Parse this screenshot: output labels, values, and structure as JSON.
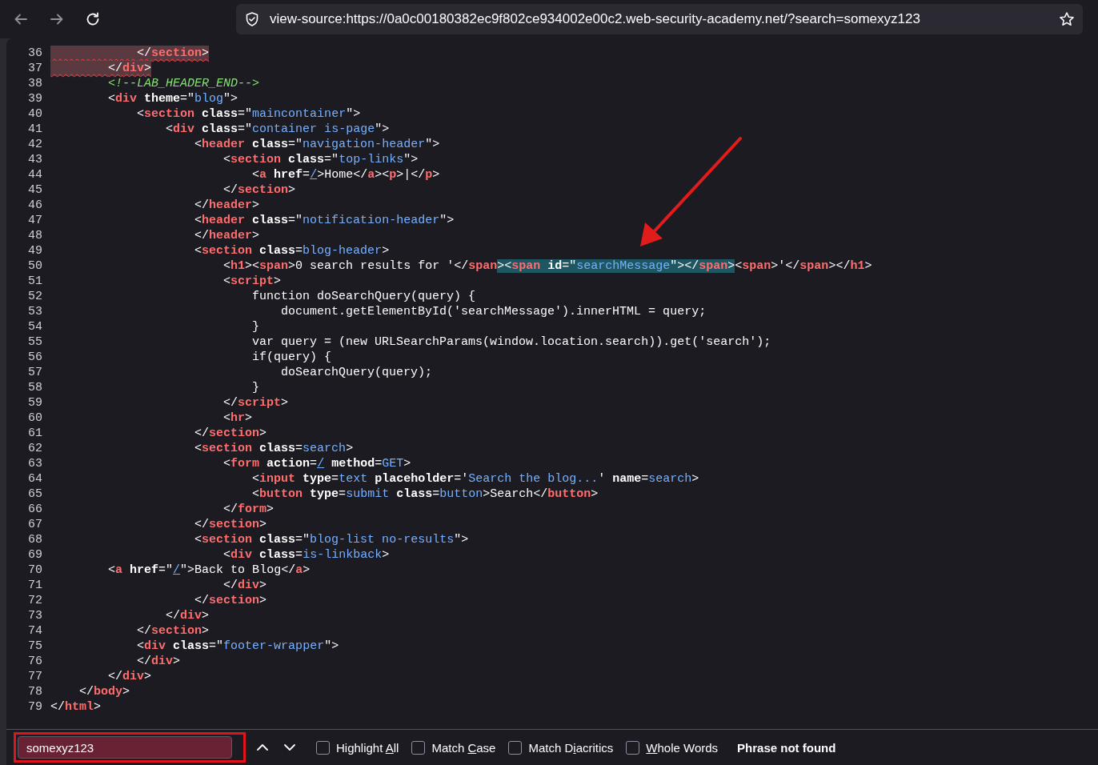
{
  "toolbar": {
    "url": "view-source:https://0a0c00180382ec9f802ce934002e00c2.web-security-academy.net/?search=somexyz123"
  },
  "source_lines": [
    {
      "number": "36",
      "error": true,
      "tokens": [
        {
          "kind": "punct",
          "text": "            </"
        },
        {
          "kind": "tag",
          "text": "section"
        },
        {
          "kind": "punct",
          "text": ">"
        }
      ]
    },
    {
      "number": "37",
      "error": true,
      "tokens": [
        {
          "kind": "punct",
          "text": "        </"
        },
        {
          "kind": "tag",
          "text": "div"
        },
        {
          "kind": "punct",
          "text": ">"
        }
      ]
    },
    {
      "number": "38",
      "error": false,
      "tokens": [
        {
          "kind": "comment",
          "text": "        <!--LAB_HEADER_END-->"
        }
      ]
    },
    {
      "number": "39",
      "error": false,
      "tokens": [
        {
          "kind": "punct",
          "text": "        <"
        },
        {
          "kind": "tag",
          "text": "div"
        },
        {
          "kind": "attr",
          "text": " theme"
        },
        {
          "kind": "punct",
          "text": "=\""
        },
        {
          "kind": "value",
          "text": "blog"
        },
        {
          "kind": "punct",
          "text": "\">"
        }
      ]
    },
    {
      "number": "40",
      "error": false,
      "tokens": [
        {
          "kind": "punct",
          "text": "            <"
        },
        {
          "kind": "tag",
          "text": "section"
        },
        {
          "kind": "attr",
          "text": " class"
        },
        {
          "kind": "punct",
          "text": "=\""
        },
        {
          "kind": "value",
          "text": "maincontainer"
        },
        {
          "kind": "punct",
          "text": "\">"
        }
      ]
    },
    {
      "number": "41",
      "error": false,
      "tokens": [
        {
          "kind": "punct",
          "text": "                <"
        },
        {
          "kind": "tag",
          "text": "div"
        },
        {
          "kind": "attr",
          "text": " class"
        },
        {
          "kind": "punct",
          "text": "=\""
        },
        {
          "kind": "value",
          "text": "container is-page"
        },
        {
          "kind": "punct",
          "text": "\">"
        }
      ]
    },
    {
      "number": "42",
      "error": false,
      "tokens": [
        {
          "kind": "punct",
          "text": "                    <"
        },
        {
          "kind": "tag",
          "text": "header"
        },
        {
          "kind": "attr",
          "text": " class"
        },
        {
          "kind": "punct",
          "text": "=\""
        },
        {
          "kind": "value",
          "text": "navigation-header"
        },
        {
          "kind": "punct",
          "text": "\">"
        }
      ]
    },
    {
      "number": "43",
      "error": false,
      "tokens": [
        {
          "kind": "punct",
          "text": "                        <"
        },
        {
          "kind": "tag",
          "text": "section"
        },
        {
          "kind": "attr",
          "text": " class"
        },
        {
          "kind": "punct",
          "text": "=\""
        },
        {
          "kind": "value",
          "text": "top-links"
        },
        {
          "kind": "punct",
          "text": "\">"
        }
      ]
    },
    {
      "number": "44",
      "error": false,
      "tokens": [
        {
          "kind": "punct",
          "text": "                            <"
        },
        {
          "kind": "tag",
          "text": "a"
        },
        {
          "kind": "attr",
          "text": " href"
        },
        {
          "kind": "punct",
          "text": "="
        },
        {
          "kind": "link",
          "text": "/"
        },
        {
          "kind": "punct",
          "text": ">Home</"
        },
        {
          "kind": "tag",
          "text": "a"
        },
        {
          "kind": "punct",
          "text": "><"
        },
        {
          "kind": "tag",
          "text": "p"
        },
        {
          "kind": "punct",
          "text": ">|</"
        },
        {
          "kind": "tag",
          "text": "p"
        },
        {
          "kind": "punct",
          "text": ">"
        }
      ]
    },
    {
      "number": "45",
      "error": false,
      "tokens": [
        {
          "kind": "punct",
          "text": "                        </"
        },
        {
          "kind": "tag",
          "text": "section"
        },
        {
          "kind": "punct",
          "text": ">"
        }
      ]
    },
    {
      "number": "46",
      "error": false,
      "tokens": [
        {
          "kind": "punct",
          "text": "                    </"
        },
        {
          "kind": "tag",
          "text": "header"
        },
        {
          "kind": "punct",
          "text": ">"
        }
      ]
    },
    {
      "number": "47",
      "error": false,
      "tokens": [
        {
          "kind": "punct",
          "text": "                    <"
        },
        {
          "kind": "tag",
          "text": "header"
        },
        {
          "kind": "attr",
          "text": " class"
        },
        {
          "kind": "punct",
          "text": "=\""
        },
        {
          "kind": "value",
          "text": "notification-header"
        },
        {
          "kind": "punct",
          "text": "\">"
        }
      ]
    },
    {
      "number": "48",
      "error": false,
      "tokens": [
        {
          "kind": "punct",
          "text": "                    </"
        },
        {
          "kind": "tag",
          "text": "header"
        },
        {
          "kind": "punct",
          "text": ">"
        }
      ]
    },
    {
      "number": "49",
      "error": false,
      "tokens": [
        {
          "kind": "punct",
          "text": "                    <"
        },
        {
          "kind": "tag",
          "text": "section"
        },
        {
          "kind": "attr",
          "text": " class"
        },
        {
          "kind": "punct",
          "text": "="
        },
        {
          "kind": "value",
          "text": "blog-header"
        },
        {
          "kind": "punct",
          "text": ">"
        }
      ]
    },
    {
      "number": "50",
      "error": false,
      "tokens": [
        {
          "kind": "punct",
          "text": "                        <",
          "selected": false
        },
        {
          "kind": "tag",
          "text": "h1",
          "selected": false
        },
        {
          "kind": "punct",
          "text": "><",
          "selected": false
        },
        {
          "kind": "tag",
          "text": "span",
          "selected": false
        },
        {
          "kind": "punct",
          "text": ">0 search results for '</",
          "selected": false
        },
        {
          "kind": "tag",
          "text": "span",
          "selected": false
        },
        {
          "kind": "punct",
          "text": "><",
          "selected": true
        },
        {
          "kind": "tag",
          "text": "span",
          "selected": true
        },
        {
          "kind": "attr",
          "text": " id",
          "selected": true
        },
        {
          "kind": "punct",
          "text": "=\"",
          "selected": true
        },
        {
          "kind": "value",
          "text": "searchMessage",
          "selected": true
        },
        {
          "kind": "punct",
          "text": "\"></",
          "selected": true
        },
        {
          "kind": "tag",
          "text": "span",
          "selected": true
        },
        {
          "kind": "punct",
          "text": ">",
          "selected": true
        },
        {
          "kind": "punct",
          "text": "<",
          "selected": false
        },
        {
          "kind": "tag",
          "text": "span",
          "selected": false
        },
        {
          "kind": "punct",
          "text": ">'</",
          "selected": false
        },
        {
          "kind": "tag",
          "text": "span",
          "selected": false
        },
        {
          "kind": "punct",
          "text": "></",
          "selected": false
        },
        {
          "kind": "tag",
          "text": "h1",
          "selected": false
        },
        {
          "kind": "punct",
          "text": ">",
          "selected": false
        }
      ]
    },
    {
      "number": "51",
      "error": false,
      "tokens": [
        {
          "kind": "punct",
          "text": "                        <"
        },
        {
          "kind": "tag",
          "text": "script"
        },
        {
          "kind": "punct",
          "text": ">"
        }
      ]
    },
    {
      "number": "52",
      "error": false,
      "tokens": [
        {
          "kind": "text",
          "text": "                            function doSearchQuery(query) {"
        }
      ]
    },
    {
      "number": "53",
      "error": false,
      "tokens": [
        {
          "kind": "text",
          "text": "                                document.getElementById('searchMessage').innerHTML = query;"
        }
      ]
    },
    {
      "number": "54",
      "error": false,
      "tokens": [
        {
          "kind": "text",
          "text": "                            }"
        }
      ]
    },
    {
      "number": "55",
      "error": false,
      "tokens": [
        {
          "kind": "text",
          "text": "                            var query = (new URLSearchParams(window.location.search)).get('search');"
        }
      ]
    },
    {
      "number": "56",
      "error": false,
      "tokens": [
        {
          "kind": "text",
          "text": "                            if(query) {"
        }
      ]
    },
    {
      "number": "57",
      "error": false,
      "tokens": [
        {
          "kind": "text",
          "text": "                                doSearchQuery(query);"
        }
      ]
    },
    {
      "number": "58",
      "error": false,
      "tokens": [
        {
          "kind": "text",
          "text": "                            }"
        }
      ]
    },
    {
      "number": "59",
      "error": false,
      "tokens": [
        {
          "kind": "punct",
          "text": "                        </"
        },
        {
          "kind": "tag",
          "text": "script"
        },
        {
          "kind": "punct",
          "text": ">"
        }
      ]
    },
    {
      "number": "60",
      "error": false,
      "tokens": [
        {
          "kind": "punct",
          "text": "                        <"
        },
        {
          "kind": "tag",
          "text": "hr"
        },
        {
          "kind": "punct",
          "text": ">"
        }
      ]
    },
    {
      "number": "61",
      "error": false,
      "tokens": [
        {
          "kind": "punct",
          "text": "                    </"
        },
        {
          "kind": "tag",
          "text": "section"
        },
        {
          "kind": "punct",
          "text": ">"
        }
      ]
    },
    {
      "number": "62",
      "error": false,
      "tokens": [
        {
          "kind": "punct",
          "text": "                    <"
        },
        {
          "kind": "tag",
          "text": "section"
        },
        {
          "kind": "attr",
          "text": " class"
        },
        {
          "kind": "punct",
          "text": "="
        },
        {
          "kind": "value",
          "text": "search"
        },
        {
          "kind": "punct",
          "text": ">"
        }
      ]
    },
    {
      "number": "63",
      "error": false,
      "tokens": [
        {
          "kind": "punct",
          "text": "                        <"
        },
        {
          "kind": "tag",
          "text": "form"
        },
        {
          "kind": "attr",
          "text": " action"
        },
        {
          "kind": "punct",
          "text": "="
        },
        {
          "kind": "link",
          "text": "/"
        },
        {
          "kind": "attr",
          "text": " method"
        },
        {
          "kind": "punct",
          "text": "="
        },
        {
          "kind": "value",
          "text": "GET"
        },
        {
          "kind": "punct",
          "text": ">"
        }
      ]
    },
    {
      "number": "64",
      "error": false,
      "tokens": [
        {
          "kind": "punct",
          "text": "                            <"
        },
        {
          "kind": "tag",
          "text": "input"
        },
        {
          "kind": "attr",
          "text": " type"
        },
        {
          "kind": "punct",
          "text": "="
        },
        {
          "kind": "value",
          "text": "text"
        },
        {
          "kind": "attr",
          "text": " placeholder"
        },
        {
          "kind": "punct",
          "text": "='"
        },
        {
          "kind": "value",
          "text": "Search the blog..."
        },
        {
          "kind": "punct",
          "text": "'"
        },
        {
          "kind": "attr",
          "text": " name"
        },
        {
          "kind": "punct",
          "text": "="
        },
        {
          "kind": "value",
          "text": "search"
        },
        {
          "kind": "punct",
          "text": ">"
        }
      ]
    },
    {
      "number": "65",
      "error": false,
      "tokens": [
        {
          "kind": "punct",
          "text": "                            <"
        },
        {
          "kind": "tag",
          "text": "button"
        },
        {
          "kind": "attr",
          "text": " type"
        },
        {
          "kind": "punct",
          "text": "="
        },
        {
          "kind": "value",
          "text": "submit"
        },
        {
          "kind": "attr",
          "text": " class"
        },
        {
          "kind": "punct",
          "text": "="
        },
        {
          "kind": "value",
          "text": "button"
        },
        {
          "kind": "punct",
          "text": ">Search</"
        },
        {
          "kind": "tag",
          "text": "button"
        },
        {
          "kind": "punct",
          "text": ">"
        }
      ]
    },
    {
      "number": "66",
      "error": false,
      "tokens": [
        {
          "kind": "punct",
          "text": "                        </"
        },
        {
          "kind": "tag",
          "text": "form"
        },
        {
          "kind": "punct",
          "text": ">"
        }
      ]
    },
    {
      "number": "67",
      "error": false,
      "tokens": [
        {
          "kind": "punct",
          "text": "                    </"
        },
        {
          "kind": "tag",
          "text": "section"
        },
        {
          "kind": "punct",
          "text": ">"
        }
      ]
    },
    {
      "number": "68",
      "error": false,
      "tokens": [
        {
          "kind": "punct",
          "text": "                    <"
        },
        {
          "kind": "tag",
          "text": "section"
        },
        {
          "kind": "attr",
          "text": " class"
        },
        {
          "kind": "punct",
          "text": "=\""
        },
        {
          "kind": "value",
          "text": "blog-list no-results"
        },
        {
          "kind": "punct",
          "text": "\">"
        }
      ]
    },
    {
      "number": "69",
      "error": false,
      "tokens": [
        {
          "kind": "punct",
          "text": "                        <"
        },
        {
          "kind": "tag",
          "text": "div"
        },
        {
          "kind": "attr",
          "text": " class"
        },
        {
          "kind": "punct",
          "text": "="
        },
        {
          "kind": "value",
          "text": "is-linkback"
        },
        {
          "kind": "punct",
          "text": ">"
        }
      ]
    },
    {
      "number": "70",
      "error": false,
      "tokens": [
        {
          "kind": "punct",
          "text": "        <"
        },
        {
          "kind": "tag",
          "text": "a"
        },
        {
          "kind": "attr",
          "text": " href"
        },
        {
          "kind": "punct",
          "text": "=\""
        },
        {
          "kind": "link",
          "text": "/"
        },
        {
          "kind": "punct",
          "text": "\">Back to Blog</"
        },
        {
          "kind": "tag",
          "text": "a"
        },
        {
          "kind": "punct",
          "text": ">"
        }
      ]
    },
    {
      "number": "71",
      "error": false,
      "tokens": [
        {
          "kind": "punct",
          "text": "                        </"
        },
        {
          "kind": "tag",
          "text": "div"
        },
        {
          "kind": "punct",
          "text": ">"
        }
      ]
    },
    {
      "number": "72",
      "error": false,
      "tokens": [
        {
          "kind": "punct",
          "text": "                    </"
        },
        {
          "kind": "tag",
          "text": "section"
        },
        {
          "kind": "punct",
          "text": ">"
        }
      ]
    },
    {
      "number": "73",
      "error": false,
      "tokens": [
        {
          "kind": "punct",
          "text": "                </"
        },
        {
          "kind": "tag",
          "text": "div"
        },
        {
          "kind": "punct",
          "text": ">"
        }
      ]
    },
    {
      "number": "74",
      "error": false,
      "tokens": [
        {
          "kind": "punct",
          "text": "            </"
        },
        {
          "kind": "tag",
          "text": "section"
        },
        {
          "kind": "punct",
          "text": ">"
        }
      ]
    },
    {
      "number": "75",
      "error": false,
      "tokens": [
        {
          "kind": "punct",
          "text": "            <"
        },
        {
          "kind": "tag",
          "text": "div"
        },
        {
          "kind": "attr",
          "text": " class"
        },
        {
          "kind": "punct",
          "text": "=\""
        },
        {
          "kind": "value",
          "text": "footer-wrapper"
        },
        {
          "kind": "punct",
          "text": "\">"
        }
      ]
    },
    {
      "number": "76",
      "error": false,
      "tokens": [
        {
          "kind": "punct",
          "text": "            </"
        },
        {
          "kind": "tag",
          "text": "div"
        },
        {
          "kind": "punct",
          "text": ">"
        }
      ]
    },
    {
      "number": "77",
      "error": false,
      "tokens": [
        {
          "kind": "punct",
          "text": "        </"
        },
        {
          "kind": "tag",
          "text": "div"
        },
        {
          "kind": "punct",
          "text": ">"
        }
      ]
    },
    {
      "number": "78",
      "error": false,
      "tokens": [
        {
          "kind": "punct",
          "text": "    </"
        },
        {
          "kind": "tag",
          "text": "body"
        },
        {
          "kind": "punct",
          "text": ">"
        }
      ]
    },
    {
      "number": "79",
      "error": false,
      "tokens": [
        {
          "kind": "punct",
          "text": "</"
        },
        {
          "kind": "tag",
          "text": "html"
        },
        {
          "kind": "punct",
          "text": ">"
        }
      ]
    }
  ],
  "find_bar": {
    "value": "somexyz123",
    "not_found": true,
    "options": [
      {
        "label_before": "Highlight ",
        "access_key": "A",
        "label_after": "ll",
        "checked": false
      },
      {
        "label_before": "Match ",
        "access_key": "C",
        "label_after": "ase",
        "checked": false
      },
      {
        "label_before": "Match D",
        "access_key": "i",
        "label_after": "acritics",
        "checked": false
      },
      {
        "access_key": "W",
        "label_after": "hole Words",
        "checked": false
      }
    ],
    "status": "Phrase not found"
  }
}
